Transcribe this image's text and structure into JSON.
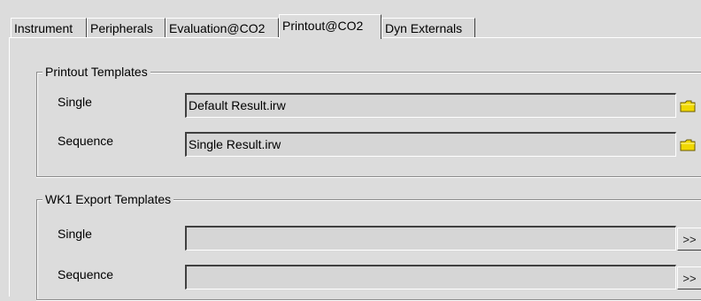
{
  "tabs": [
    {
      "label": "Instrument"
    },
    {
      "label": "Peripherals"
    },
    {
      "label": "Evaluation@CO2"
    },
    {
      "label": "Printout@CO2",
      "active": true
    },
    {
      "label": "Dyn Externals"
    }
  ],
  "printout_templates": {
    "title": "Printout Templates",
    "single": {
      "label": "Single",
      "value": "Default Result.irw",
      "icon": "folder-icon"
    },
    "sequence": {
      "label": "Sequence",
      "value": "Single Result.irw",
      "icon": "folder-icon"
    }
  },
  "wk1_export_templates": {
    "title": "WK1 Export Templates",
    "single": {
      "label": "Single",
      "value": "",
      "button_label": ">>"
    },
    "sequence": {
      "label": "Sequence",
      "value": "",
      "button_label": ">>"
    }
  },
  "colors": {
    "folder": "#f0d800",
    "panel": "#dcdcdc"
  }
}
